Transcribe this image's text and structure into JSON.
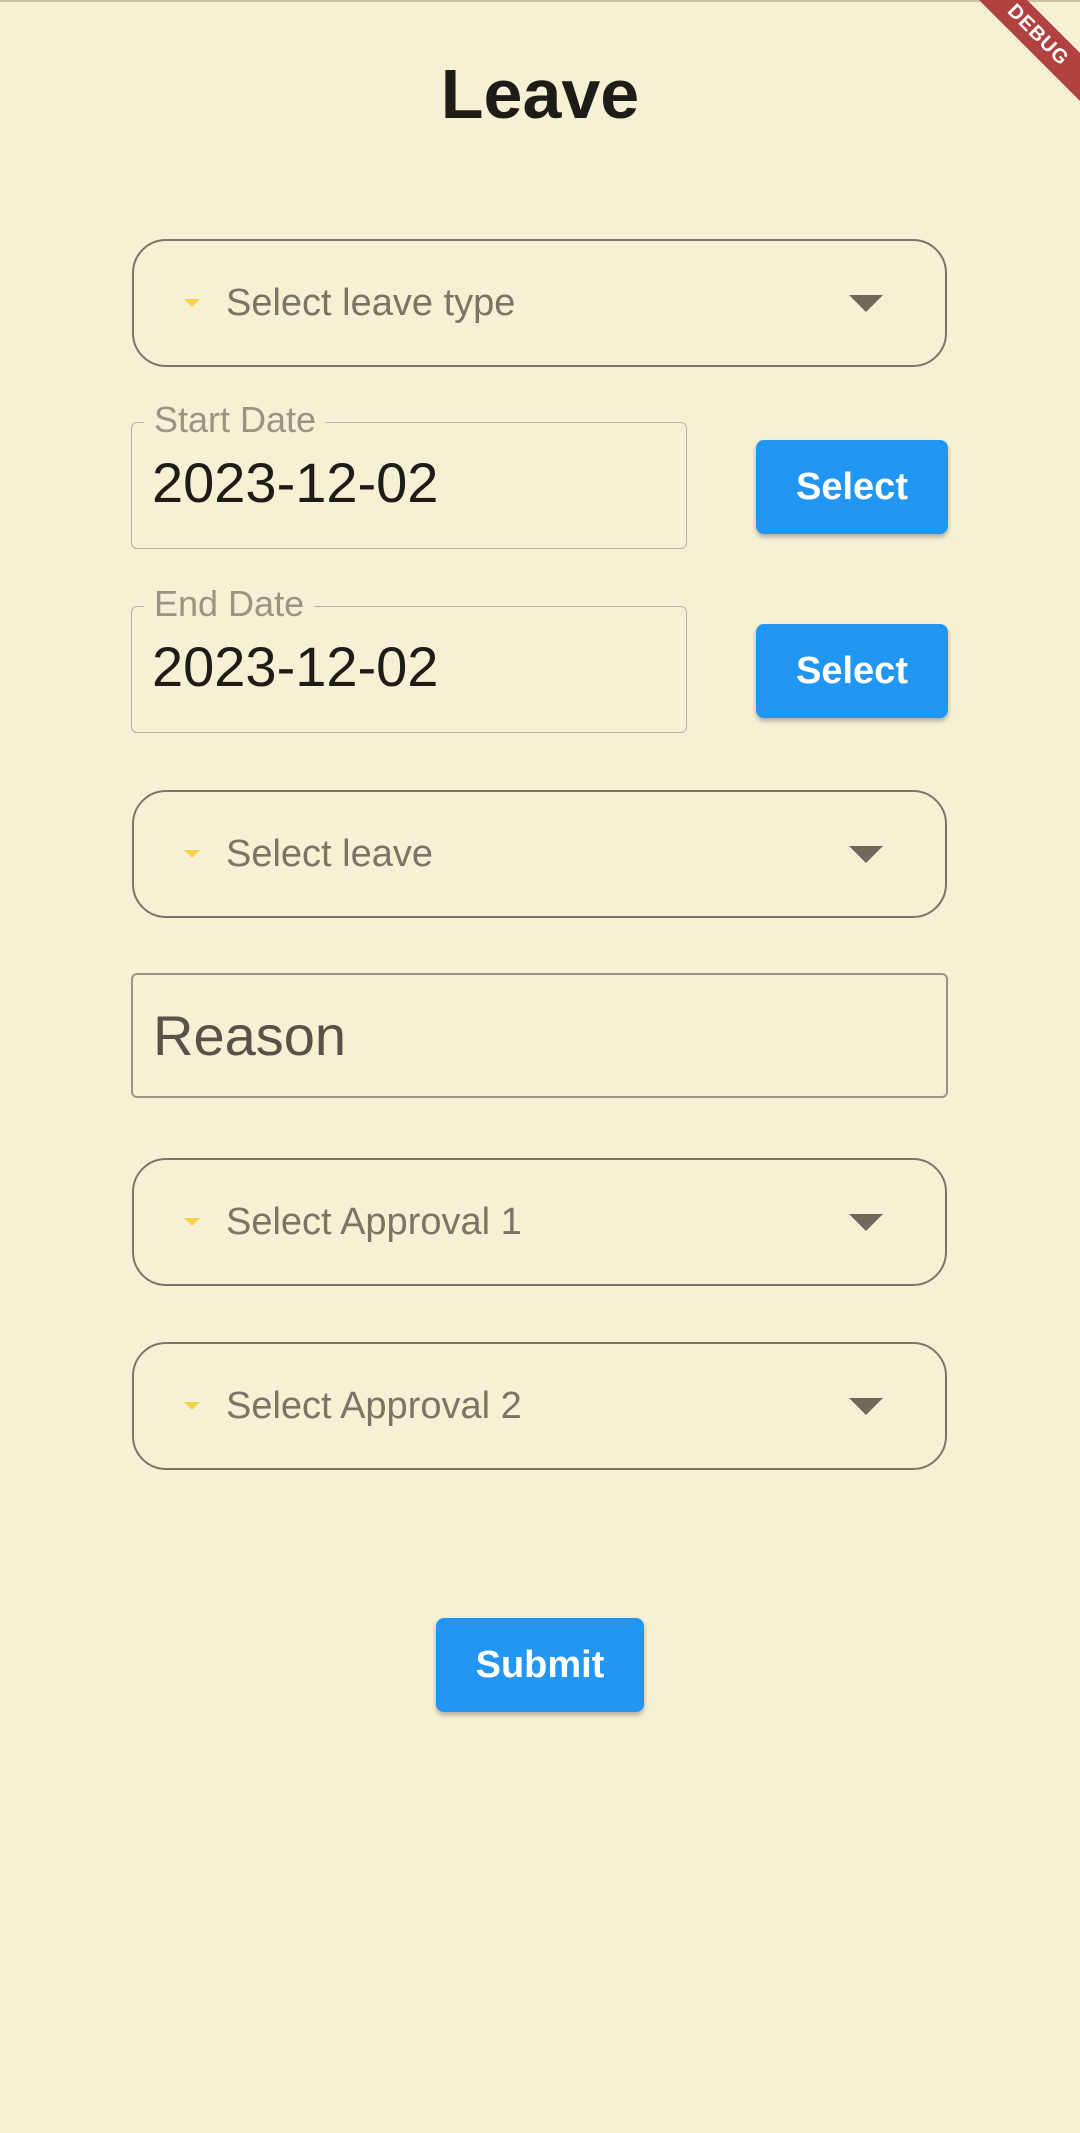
{
  "page": {
    "title": "Leave",
    "background": "#f6f0d4",
    "accent": "#2196f3",
    "debug_banner": "DEBUG"
  },
  "leave_type": {
    "placeholder": "Select leave type",
    "lead_icon": "arrow-drop-down-icon",
    "trailing_icon": "caret-down-icon"
  },
  "start_date": {
    "label": "Start Date",
    "value": "2023-12-02",
    "button": "Select"
  },
  "end_date": {
    "label": "End Date",
    "value": "2023-12-02",
    "button": "Select"
  },
  "leave": {
    "placeholder": "Select leave"
  },
  "reason": {
    "placeholder": "Reason"
  },
  "approval1": {
    "placeholder": "Select Approval 1"
  },
  "approval2": {
    "placeholder": "Select Approval 2"
  },
  "submit": {
    "label": "Submit"
  }
}
